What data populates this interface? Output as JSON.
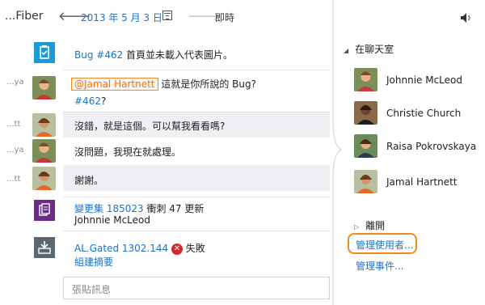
{
  "header": {
    "title": "...Fiber",
    "date": "2013 年 5 月 3 日",
    "live_label": "即時"
  },
  "messages": [
    {
      "sender": "",
      "icon": "bug-icon",
      "link": "Bug #462",
      "text": " 首頁並未載入代表圖片。"
    },
    {
      "sender": "...ya",
      "mention": "@Jamal Hartnett",
      "text": " 這就是你所說的 Bug?",
      "link": "#462",
      "tail": "?"
    },
    {
      "sender": "...tt",
      "text": "沒錯，就是這個。可以幫我看看嗎?"
    },
    {
      "sender": "...ya",
      "text": "沒問題，我現在就處理。"
    },
    {
      "sender": "...tt",
      "text": "謝謝。"
    },
    {
      "sender": "",
      "icon": "changeset-icon",
      "link": "變更集 185023",
      "text": " 衝刺 47 更新",
      "line2": "Johnnie McLeod"
    },
    {
      "sender": "",
      "icon": "build-icon",
      "link": "AL.Gated 1302.144",
      "status": "失敗",
      "line2_link": "組建摘要"
    }
  ],
  "input": {
    "placeholder": "張貼訊息"
  },
  "room": {
    "heading": "在聊天室",
    "members": [
      "Johnnie McLeod",
      "Christie Church",
      "Raisa Pokrovskaya",
      "Jamal Hartnett"
    ],
    "leave_label": "離開",
    "manage_users": "管理使用者...",
    "manage_events": "管理事件..."
  },
  "colors": {
    "accent": "#1a73c8",
    "bug": "#1a9ad6",
    "changeset": "#6b2d86",
    "build": "#5b6770",
    "highlight": "#f28c1d",
    "fail": "#d9262c"
  }
}
